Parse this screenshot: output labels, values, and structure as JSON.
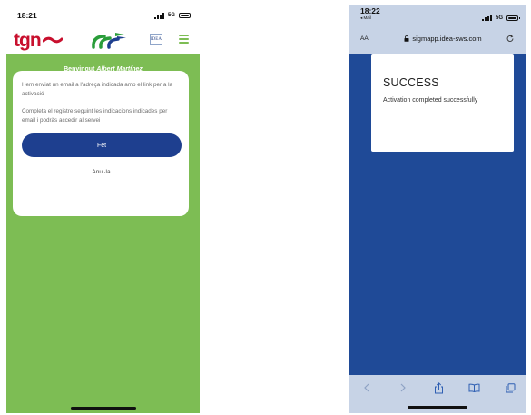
{
  "left_screen": {
    "status": {
      "time": "18:21",
      "network": "5G"
    },
    "header": {
      "logo_tgn": "tgn",
      "logo_idea": "IDEA",
      "accent_color": "#7dbd54",
      "brand_red": "#c8102e",
      "fcc_colors": [
        "#2a9d3a",
        "#1e3f8f"
      ]
    },
    "welcome": {
      "prefix": "Benvingut",
      "name": "Albert Martínez"
    },
    "card": {
      "message_1": "Hem enviat un email a l'adreça indicada amb el link per a la activació",
      "message_2": "Completa el registre seguint les indicacions indicades per email i podràs accedir al servei",
      "primary_button": "Fet",
      "primary_color": "#1e3f8f",
      "secondary_link": "Anul·la"
    },
    "background_color": "#7dbd54"
  },
  "right_screen": {
    "status": {
      "time": "18:22",
      "back_label": "◂ Mail",
      "network": "5G"
    },
    "browser": {
      "text_size_label": "AA",
      "url": "sigmapp.idea-sws.com",
      "reload_icon": "reload-icon"
    },
    "dialog": {
      "title": "SUCCESS",
      "message": "Activation completed successfully"
    },
    "toolbar": {
      "buttons": [
        "back-icon",
        "forward-icon",
        "share-icon",
        "bookmarks-icon",
        "tabs-icon"
      ]
    },
    "background_color": "#1f4a97",
    "chrome_color": "#c7d3e6"
  }
}
